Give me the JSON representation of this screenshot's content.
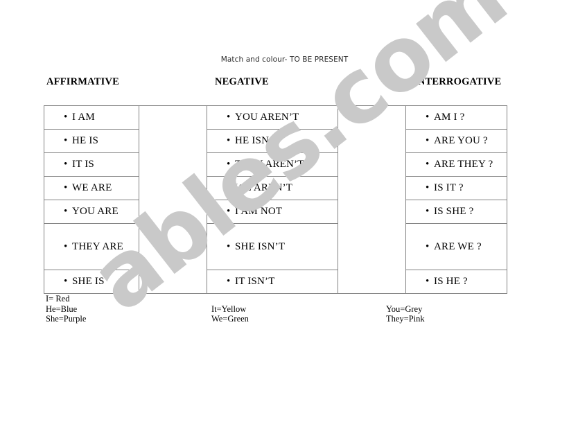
{
  "document": {
    "title": "Match and colour- TO BE PRESENT",
    "watermark": "ables.com"
  },
  "headers": {
    "affirmative": "AFFIRMATIVE",
    "negative": "NEGATIVE",
    "interrogative": "INTERROGATIVE"
  },
  "columns": {
    "affirmative": [
      "I AM",
      "HE IS",
      "IT IS",
      "WE ARE",
      "YOU ARE",
      "THEY  ARE",
      "SHE IS"
    ],
    "negative": [
      "YOU AREN’T",
      "HE ISN’T",
      "THEY AREN’T",
      "WE AREN’T",
      "I AM NOT",
      "SHE ISN’T",
      "IT ISN’T"
    ],
    "interrogative": [
      "AM I ?",
      "ARE YOU ?",
      "ARE THEY ?",
      "IS IT ?",
      "IS SHE ?",
      "ARE WE ?",
      "IS HE ?"
    ]
  },
  "legend": {
    "groups": [
      {
        "lines": [
          "I= Red",
          "He=Blue",
          "She=Purple"
        ]
      },
      {
        "lines": [
          "It=Yellow",
          "We=Green"
        ]
      },
      {
        "lines": [
          "You=Grey",
          "They=Pink"
        ]
      }
    ]
  },
  "colors": {
    "border": "#808080",
    "text": "#000000",
    "title": "#2b2b2b",
    "watermark": "#c9c9c9",
    "page_background": "#ffffff"
  }
}
